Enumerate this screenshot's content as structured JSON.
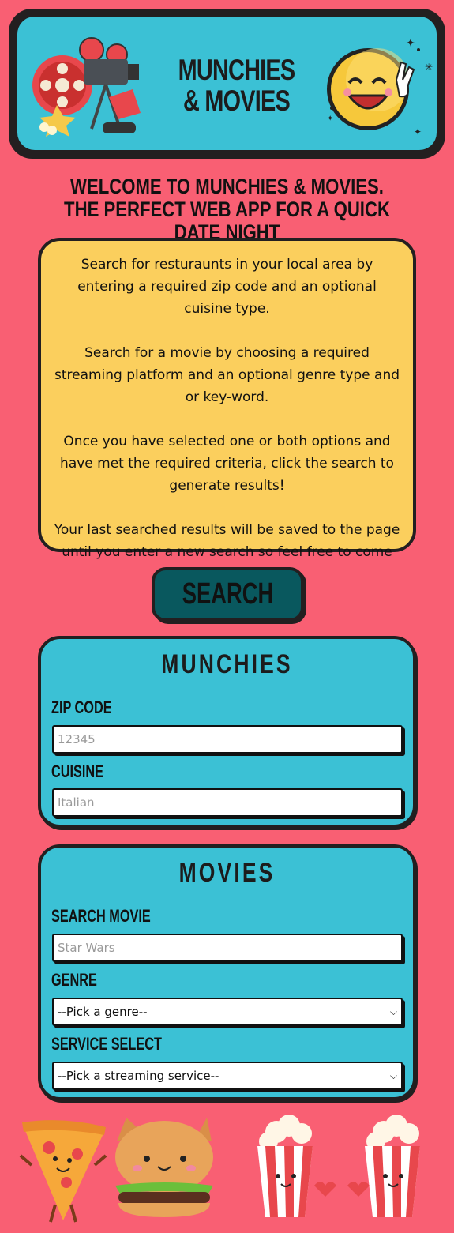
{
  "header": {
    "title": "MUNCHIES & MOVIES"
  },
  "welcome": {
    "line1": "WELCOME TO MUNCHIES & MOVIES.",
    "line2": "THE PERFECT WEB APP FOR A QUICK DATE NIGHT"
  },
  "info": {
    "p1": "Search for resturaunts in your local area by entering a required zip code and an optional cuisine type.",
    "p2": "Search for a movie by choosing a required streaming platform and an optional genre type and or key-word.",
    "p3": "Once you have selected one or both options and have met the required criteria, click the search to generate results!",
    "p4": "Your last searched results will be saved to the page until you enter a new search so feel free to come back later!"
  },
  "search_button": "SEARCH",
  "munchies": {
    "title": "MUNCHIES",
    "zip_label": "ZIP CODE",
    "zip_placeholder": "12345",
    "cuisine_label": "CUISINE",
    "cuisine_placeholder": "Italian"
  },
  "movies": {
    "title": "MOVIES",
    "search_label": "SEARCH MOVIE",
    "search_placeholder": "Star Wars",
    "genre_label": "GENRE",
    "genre_selected": "--Pick a genre--",
    "service_label": "SERVICE SELECT",
    "service_selected": "--Pick a streaming service--"
  },
  "colors": {
    "background": "#f95f73",
    "header_teal": "#3bc1d5",
    "info_yellow": "#fbcf5d",
    "button_teal": "#09585e",
    "outline": "#231f20"
  },
  "icons": [
    "film-projector-icon",
    "smiley-peace-icon",
    "pizza-icon",
    "cat-burger-icon",
    "popcorn-couple-icon"
  ]
}
